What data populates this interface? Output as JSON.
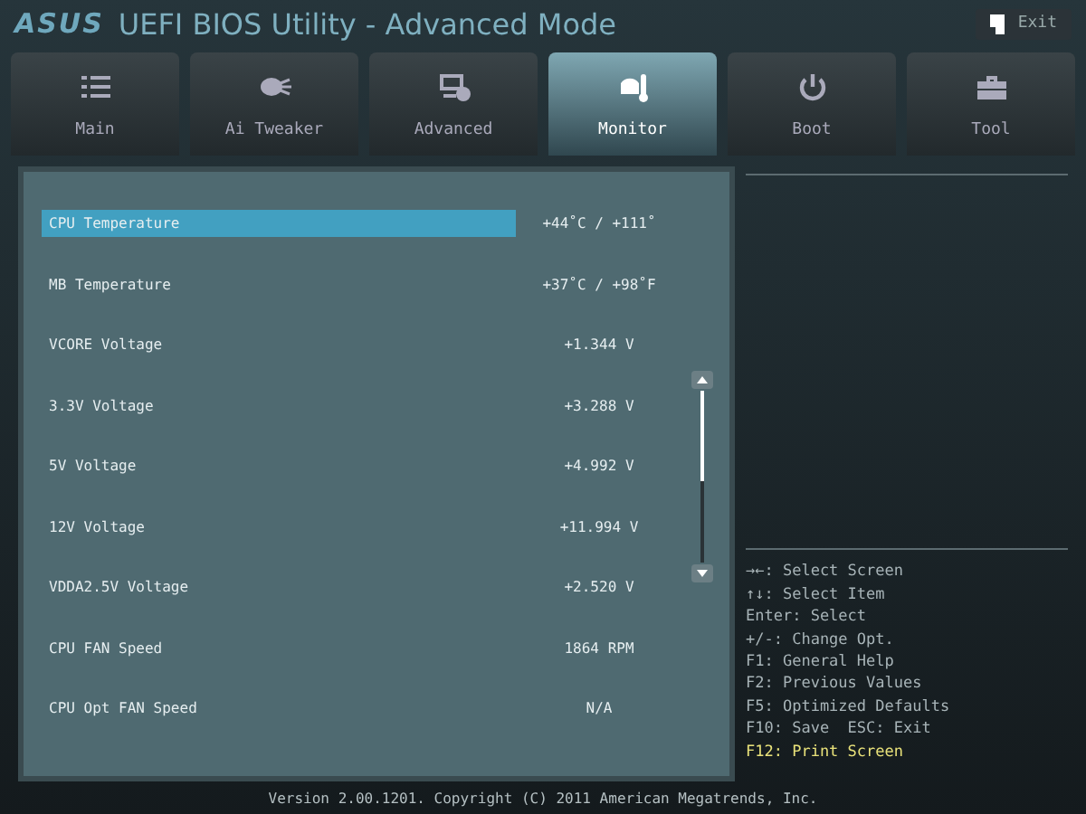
{
  "header": {
    "logo": "ASUS",
    "title": "UEFI BIOS Utility - Advanced Mode",
    "exit_label": "Exit"
  },
  "tabs": [
    {
      "label": "Main",
      "kind": "list",
      "selected": false
    },
    {
      "label": "Ai Tweaker",
      "kind": "fan",
      "selected": false
    },
    {
      "label": "Advanced",
      "kind": "monitor",
      "selected": false
    },
    {
      "label": "Monitor",
      "kind": "thermo",
      "selected": true
    },
    {
      "label": "Boot",
      "kind": "power",
      "selected": false
    },
    {
      "label": "Tool",
      "kind": "toolbox",
      "selected": false
    }
  ],
  "items": [
    {
      "label": "CPU Temperature",
      "value": "+44˚C / +111˚",
      "selected": true
    },
    {
      "label": "MB Temperature",
      "value": "+37˚C / +98˚F",
      "selected": false
    },
    {
      "label": "VCORE Voltage",
      "value": "+1.344 V",
      "selected": false
    },
    {
      "label": "3.3V Voltage",
      "value": "+3.288 V",
      "selected": false
    },
    {
      "label": "5V Voltage",
      "value": "+4.992 V",
      "selected": false
    },
    {
      "label": "12V Voltage",
      "value": "+11.994 V",
      "selected": false
    },
    {
      "label": "VDDA2.5V Voltage",
      "value": "+2.520 V",
      "selected": false
    },
    {
      "label": "CPU FAN Speed",
      "value": "1864 RPM",
      "selected": false
    },
    {
      "label": "CPU Opt FAN Speed",
      "value": "N/A",
      "selected": false
    }
  ],
  "help": [
    {
      "text": "→←: Select Screen",
      "highlighted": false
    },
    {
      "text": "↑↓: Select Item",
      "highlighted": false
    },
    {
      "text": "Enter: Select",
      "highlighted": false
    },
    {
      "text": "+/-: Change Opt.",
      "highlighted": false
    },
    {
      "text": "F1: General Help",
      "highlighted": false
    },
    {
      "text": "F2: Previous Values",
      "highlighted": false
    },
    {
      "text": "F5: Optimized Defaults",
      "highlighted": false
    },
    {
      "text": "F10: Save  ESC: Exit",
      "highlighted": false
    },
    {
      "text": "F12: Print Screen",
      "highlighted": true
    }
  ],
  "footer": "Version 2.00.1201. Copyright (C) 2011 American Megatrends, Inc."
}
